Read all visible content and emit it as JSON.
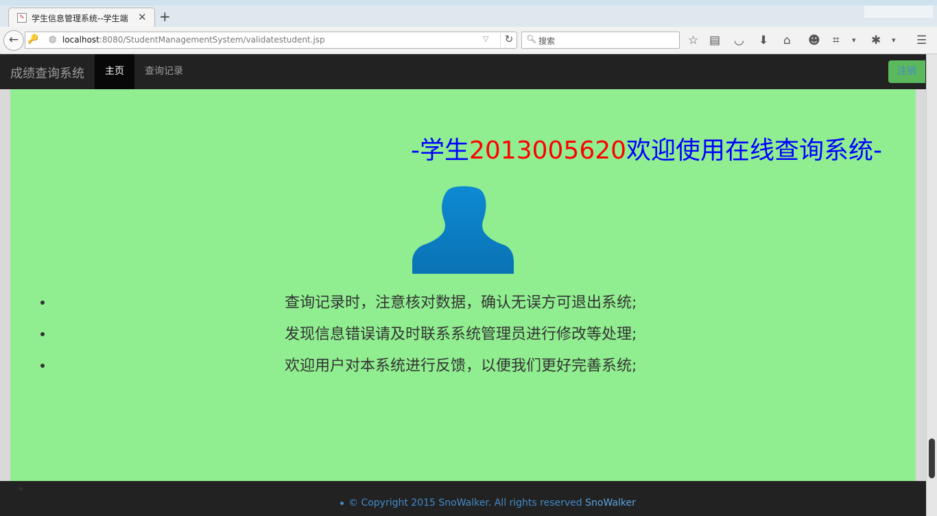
{
  "browser": {
    "tab_title": "学生信息管理系统--学生端",
    "url_host": "localhost",
    "url_path": ":8080/StudentManagementSystem/validatestudent.jsp",
    "search_placeholder": "搜索"
  },
  "site": {
    "brand": "成绩查询系统",
    "nav": {
      "home": "主页",
      "records": "查询记录"
    },
    "logout_label": "注销"
  },
  "welcome": {
    "prefix": "-学生",
    "student_id": "2013005620",
    "suffix": "欢迎使用在线查询系统-"
  },
  "notices": [
    "查询记录时，注意核对数据，确认无误方可退出系统;",
    "发现信息错误请及时联系系统管理员进行修改等处理;",
    "欢迎用户对本系统进行反馈，以便我们更好完善系统;"
  ],
  "footer": {
    "copyright": "© Copyright 2015 SnoWalker. All rights reserved ",
    "link": "SnoWalker"
  },
  "colors": {
    "content_bg": "#90ee90",
    "navbar_bg": "#222222",
    "welcome_blue": "#0000ff",
    "welcome_red": "#ff0000",
    "logout_bg": "#5cb85c",
    "link_blue": "#428bca",
    "avatar_blue": "#0a7fc6"
  }
}
